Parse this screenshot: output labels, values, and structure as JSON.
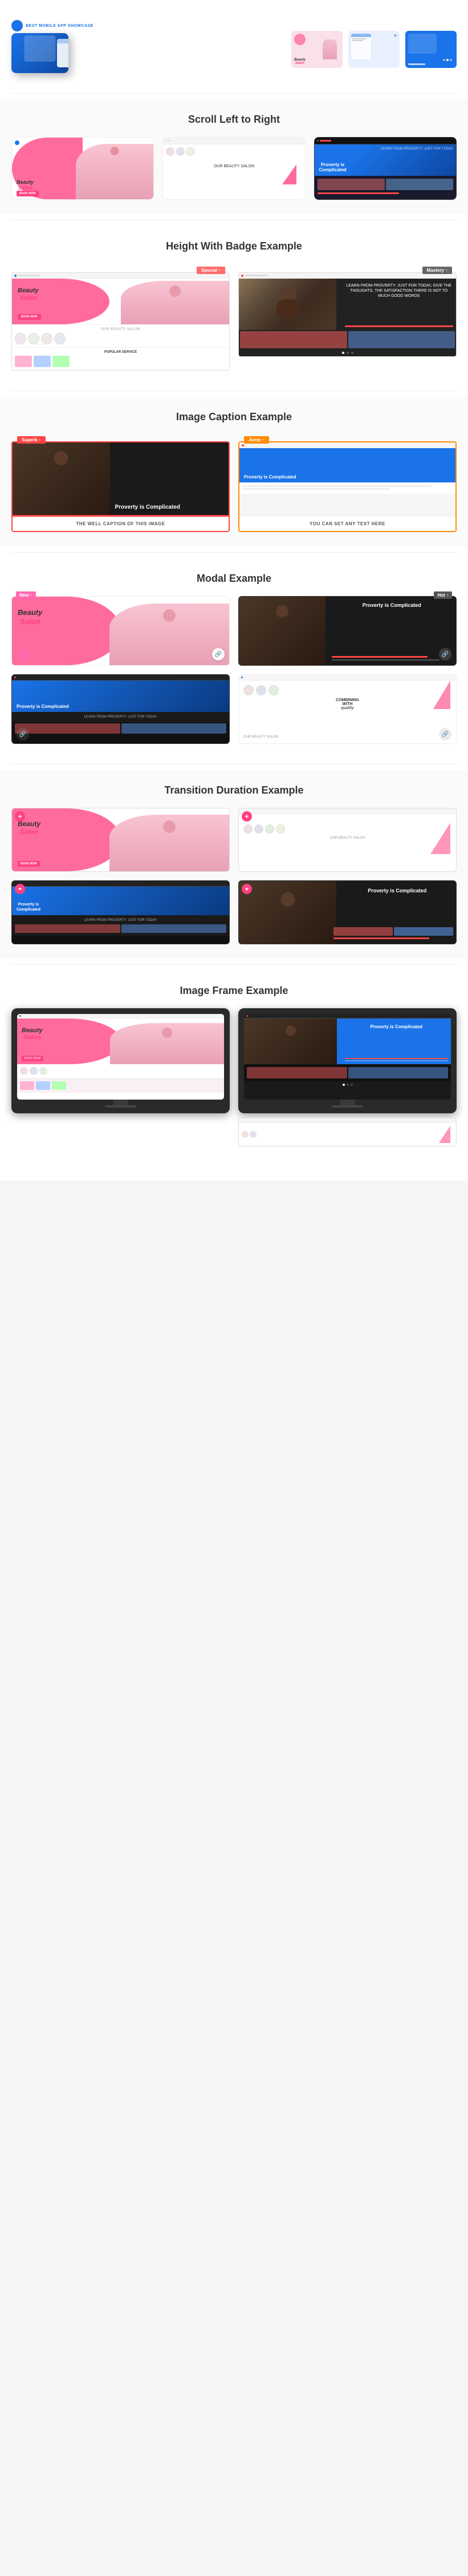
{
  "sections": {
    "app_showcase": {
      "logo_text": "BEST MOBILE APP SHOWCASE",
      "subtitle": ""
    },
    "scroll": {
      "title": "Scroll Left to Right"
    },
    "height_badge": {
      "title": "Height With Badge Example",
      "badge1": "Special ↑",
      "badge2": "Mastery ↑"
    },
    "image_caption": {
      "title": "Image Caption Example",
      "badge1": "Superb ↑",
      "badge2": "Jump ↑",
      "caption1": "THE WELL CAPTION OF THIS IMAGE",
      "caption2": "YOU CAN SET ANY TEXT HERE"
    },
    "modal": {
      "title": "Modal Example",
      "badge1": "New ↑",
      "badge2": "Hot ↑"
    },
    "transition": {
      "title": "Transition Duration Example"
    },
    "image_frame": {
      "title": "Image Frame Example"
    }
  },
  "cards": {
    "beauty_salon": {
      "title": "Beauty",
      "title2": "Salon",
      "subtitle": "OUR BEAUTY SALON",
      "btn_text": "BOOK NOW"
    },
    "poverty": {
      "title": "Proverty is Complicated",
      "body_text": "LEARN FROM PROVERTY: JUST FOR TODAY, GIVE THE THOUGHTS, THE SATISFACTION THERE IS NOT TO MUCH GOOD WORDS"
    },
    "text_placeholder": "YOU CAN SET ANY TEXT HERE"
  },
  "icons": {
    "link": "🔗",
    "plus": "+",
    "arrow": "→"
  },
  "colors": {
    "primary_blue": "#1a73e8",
    "pink": "#ff6b9d",
    "hot_pink": "#ff4081",
    "red": "#ff4444",
    "orange": "#ff8c00",
    "dark": "#222222",
    "light_gray": "#f5f5f5"
  }
}
